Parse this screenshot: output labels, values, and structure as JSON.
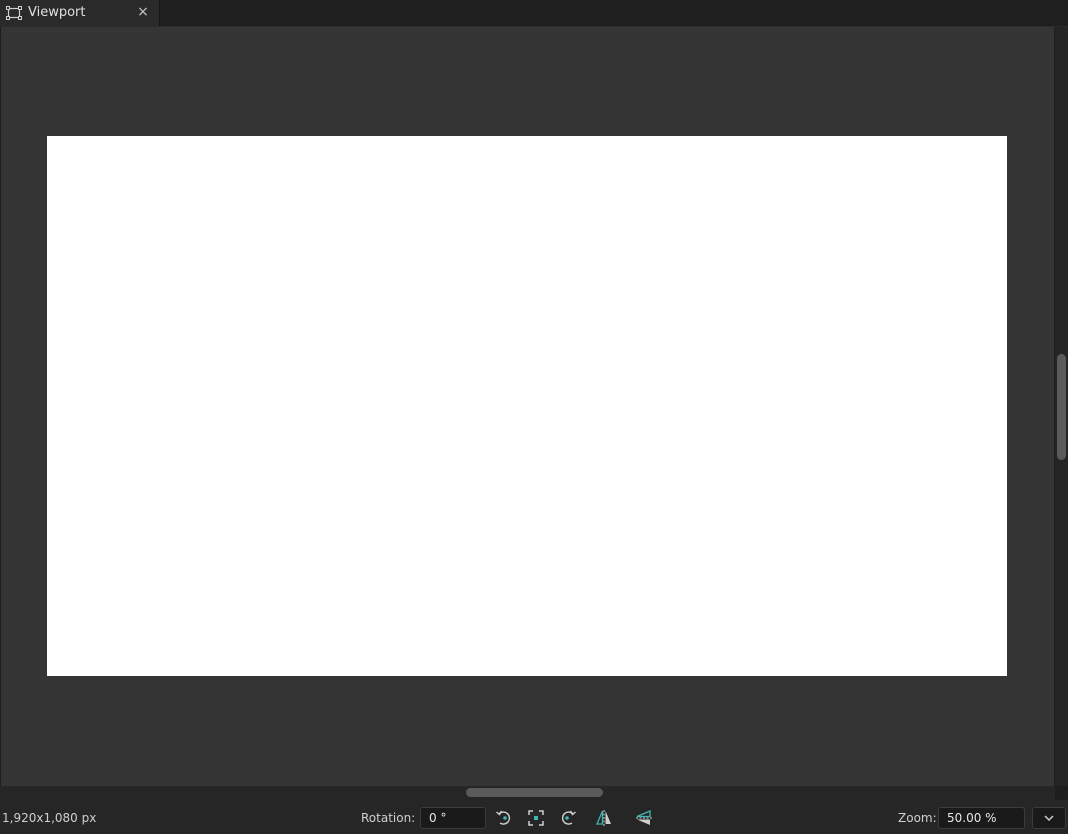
{
  "tab": {
    "title": "Viewport",
    "icon": "viewport-frame-icon",
    "close_label": "×"
  },
  "statusbar": {
    "canvas_size": "1,920x1,080 px",
    "rotation_label": "Rotation:",
    "rotation_value": "0 °",
    "zoom_label": "Zoom:",
    "zoom_value": "50.00 %"
  },
  "toolbar_icons": [
    "rotate-left-icon",
    "fit-to-view-icon",
    "rotate-right-icon",
    "flip-horizontal-icon",
    "flip-vertical-icon"
  ],
  "colors": {
    "accent": "#3fb6b2",
    "canvas": "#ffffff",
    "viewport_bg": "#353535"
  }
}
